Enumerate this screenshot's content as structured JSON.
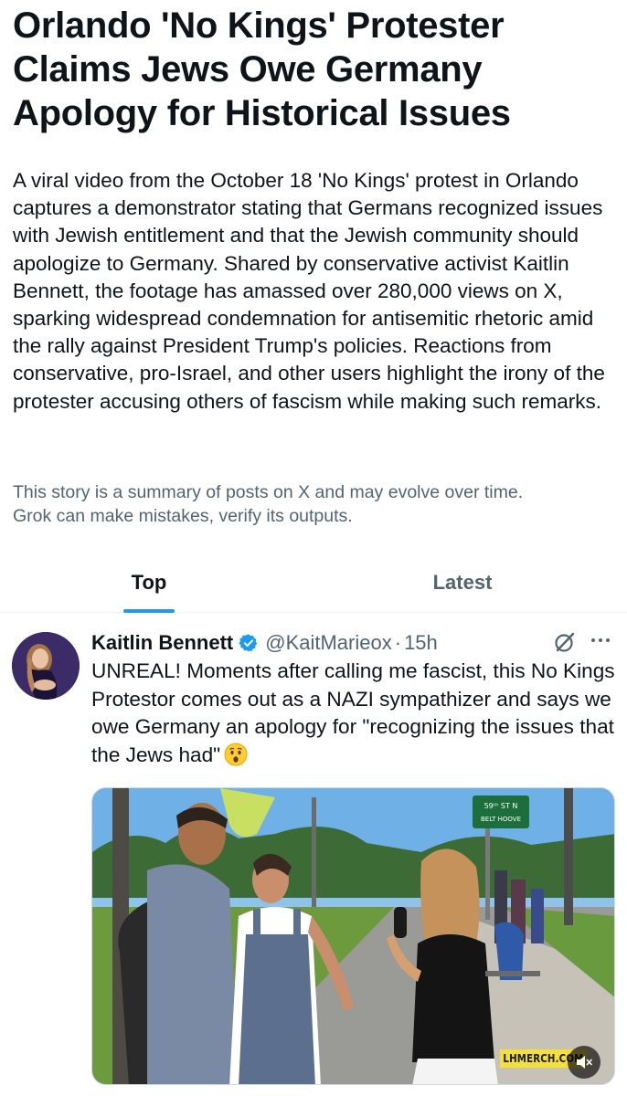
{
  "article": {
    "headline": "Orlando 'No Kings' Protester Claims Jews Owe Germany Apology for Historical Issues",
    "summary": "A viral video from the October 18 'No Kings' protest in Orlando captures a demonstrator stating that Germans recognized issues with Jewish entitlement and that the Jewish community should apologize to Germany. Shared by conservative activist Kaitlin Bennett, the footage has amassed over 280,000 views on X, sparking widespread condemnation for antisemitic rhetoric amid the rally against President Trump's policies. Reactions from conservative, pro-Israel, and other users highlight the irony of the protester accusing others of fascism while making such remarks.",
    "disclaimer_line1": "This story is a summary of posts on X and may evolve over time.",
    "disclaimer_line2": "Grok can make mistakes, verify its outputs."
  },
  "tabs": [
    {
      "label": "Top",
      "active": true
    },
    {
      "label": "Latest",
      "active": false
    }
  ],
  "post": {
    "author_name": "Kaitlin Bennett",
    "verified": true,
    "handle": "@KaitMarieox",
    "separator": "·",
    "time": "15h",
    "text": "UNREAL! Moments after calling me fascist, this No Kings Protestor comes out as a NAZI sympathizer and says we owe Germany an apology for \"recognizing the issues that the Jews had\"",
    "emoji": "hushed-face-emoji",
    "media": {
      "type": "video",
      "watermark": "LHMERCH.COM",
      "street_sign_line1": "59ᵗʰ ST N",
      "street_sign_line2": "BELT HOOVE"
    }
  },
  "colors": {
    "text_primary": "#0f1419",
    "text_secondary": "#536471",
    "accent": "#1d9bf0",
    "verified_badge": "#1d9bf0",
    "watermark_bg": "#f3e03a"
  },
  "icons": {
    "verified": "verified-badge-icon",
    "grok": "grok-icon",
    "more": "more-options-icon",
    "mute": "mute-icon"
  }
}
